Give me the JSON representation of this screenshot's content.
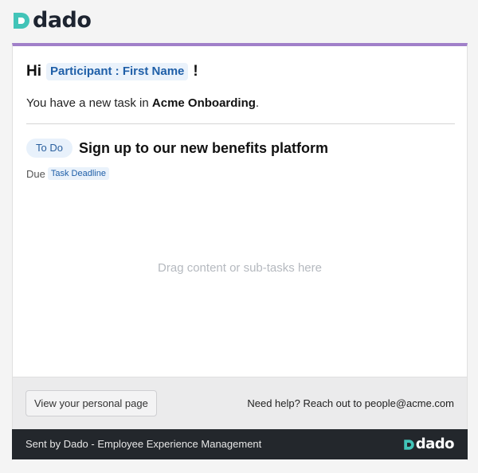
{
  "brand": {
    "name": "dado",
    "colors": {
      "teal": "#42c4b8",
      "dark": "#1d2430",
      "accent": "#a07fc9"
    }
  },
  "email": {
    "greeting_prefix": "Hi",
    "recipient_tag": "Participant : First Name",
    "greeting_suffix": "!",
    "intro_text": "You have a new task in ",
    "workspace": "Acme Onboarding",
    "intro_end": "."
  },
  "task": {
    "status": "To Do",
    "title": "Sign up to our new benefits platform",
    "due_label": "Due",
    "due_tag": "Task Deadline"
  },
  "dropzone": {
    "placeholder": "Drag content or sub-tasks here"
  },
  "footer": {
    "personal_page_button": "View your personal page",
    "help_text": "Need help? Reach out to people@acme.com"
  },
  "bottom_bar": {
    "sent_by": "Sent by Dado - Employee Experience Management",
    "brand_name": "dado"
  }
}
